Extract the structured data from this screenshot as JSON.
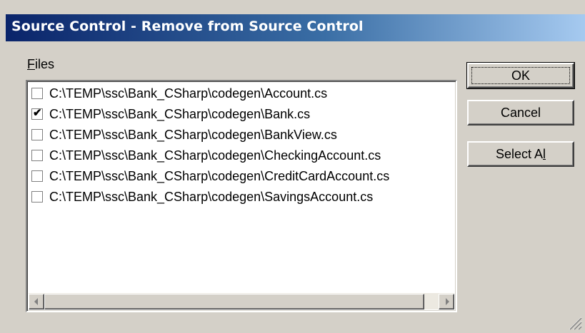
{
  "window": {
    "title": "Source Control - Remove from Source Control"
  },
  "files": {
    "label_accel": "F",
    "label_rest": "iles",
    "items": [
      {
        "path": "C:\\TEMP\\ssc\\Bank_CSharp\\codegen\\Account.cs",
        "checked": false
      },
      {
        "path": "C:\\TEMP\\ssc\\Bank_CSharp\\codegen\\Bank.cs",
        "checked": true
      },
      {
        "path": "C:\\TEMP\\ssc\\Bank_CSharp\\codegen\\BankView.cs",
        "checked": false
      },
      {
        "path": "C:\\TEMP\\ssc\\Bank_CSharp\\codegen\\CheckingAccount.cs",
        "checked": false
      },
      {
        "path": "C:\\TEMP\\ssc\\Bank_CSharp\\codegen\\CreditCardAccount.cs",
        "checked": false
      },
      {
        "path": "C:\\TEMP\\ssc\\Bank_CSharp\\codegen\\SavingsAccount.cs",
        "checked": false
      }
    ],
    "checkmark_glyph": "✔"
  },
  "buttons": {
    "ok_label": "OK",
    "cancel_label": "Cancel",
    "select_all_before": "Select A",
    "select_all_accel": "l",
    "select_all_after": "l"
  },
  "icons": {
    "scroll_left": "scroll-left-arrow-icon",
    "scroll_right": "scroll-right-arrow-icon",
    "resize_grip": "resize-grip-icon"
  },
  "colors": {
    "title_start": "#0a246a",
    "title_end": "#a6caf0",
    "face": "#d4d0c8"
  }
}
